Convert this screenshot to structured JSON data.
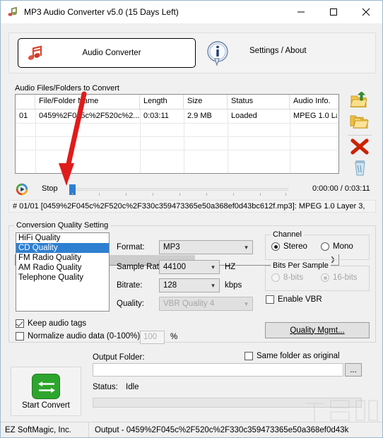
{
  "window": {
    "title": "MP3 Audio Converter v5.0 (15 Days Left)",
    "icon": "app-music-icon",
    "minimize": "minimize-icon",
    "maximize": "maximize-icon",
    "close": "close-icon"
  },
  "toolbar": {
    "audio_converter_label": "Audio Converter",
    "audio_converter_icon": "music-note-icon",
    "info_icon": "info-bubble-icon",
    "settings_about_label": "Settings / About"
  },
  "files_group": {
    "legend": "Audio Files/Folders to Convert",
    "columns": [
      "",
      "File/Folder Name",
      "Length",
      "Size",
      "Status",
      "Audio Info."
    ],
    "rows": [
      {
        "index": "01",
        "name": "0459%2F045c%2F520c%2...",
        "length": "0:03:11",
        "size": "2.9 MB",
        "status": "Loaded",
        "info": "MPEG 1.0 La"
      }
    ],
    "scroll_left_icon": "chevron-left-icon",
    "scroll_right_icon": "chevron-right-icon",
    "side_buttons": [
      {
        "name": "add-files-icon",
        "label": "Add Files"
      },
      {
        "name": "add-folder-icon",
        "label": "Add Folder"
      },
      {
        "name": "remove-icon",
        "label": "Remove"
      },
      {
        "name": "clear-all-icon",
        "label": "Clear All"
      }
    ]
  },
  "player": {
    "play_icon": "play-media-icon",
    "stop_label": "Stop",
    "position": "0:00:00",
    "duration": "0:03:11",
    "time_display": "0:00:00 / 0:03:11",
    "seek_value": 0
  },
  "info_line": "# 01/01 [0459%2F045c%2F520c%2F330c359473365e50a368ef0d43bc612f.mp3]: MPEG 1.0 Layer 3,",
  "quality_group": {
    "legend": "Conversion Quality Setting",
    "presets": [
      "HiFi Quality",
      "CD Quality",
      "FM Radio Quality",
      "AM Radio Quality",
      "Telephone Quality"
    ],
    "selected_preset": "CD Quality",
    "fields": {
      "format_label": "Format:",
      "format_value": "MP3",
      "sample_rate_label": "Sample Rate:",
      "sample_rate_value": "44100",
      "sample_rate_unit": "HZ",
      "bitrate_label": "Bitrate:",
      "bitrate_value": "128",
      "bitrate_unit": "kbps",
      "quality_label": "Quality:",
      "quality_value": "VBR Quality 4"
    },
    "channel": {
      "legend": "Channel",
      "options": [
        "Stereo",
        "Mono"
      ],
      "selected": "Stereo"
    },
    "bits_per_sample": {
      "legend": "Bits Per Sample",
      "options": [
        "8-bits",
        "16-bits"
      ],
      "selected": "16-bits"
    },
    "enable_vbr_label": "Enable VBR",
    "enable_vbr_checked": false,
    "keep_tags_label": "Keep audio tags",
    "keep_tags_checked": true,
    "normalize_label": "Normalize audio data (0-100%):",
    "normalize_checked": false,
    "normalize_value": "100",
    "normalize_unit": "%",
    "quality_mgmt_label": "Quality Mgmt..."
  },
  "output": {
    "folder_label": "Output Folder:",
    "folder_value": "",
    "folder_placeholder": "",
    "same_folder_label": "Same folder as original",
    "same_folder_checked": false,
    "browse_label": "...",
    "status_label": "Status:",
    "status_value": "Idle",
    "progress_percent": 0
  },
  "start_button": {
    "label": "Start Convert",
    "icon": "convert-arrows-icon"
  },
  "statusbar": {
    "company": "EZ SoftMagic, Inc.",
    "output_text": "Output - 0459%2F045c%2F520c%2F330c359473365e50a368ef0d43k"
  },
  "colors": {
    "accent": "#2e7fd1",
    "start_green": "#2ea52e",
    "remove_red": "#cc2200",
    "window_border": "#9bb7cc"
  }
}
